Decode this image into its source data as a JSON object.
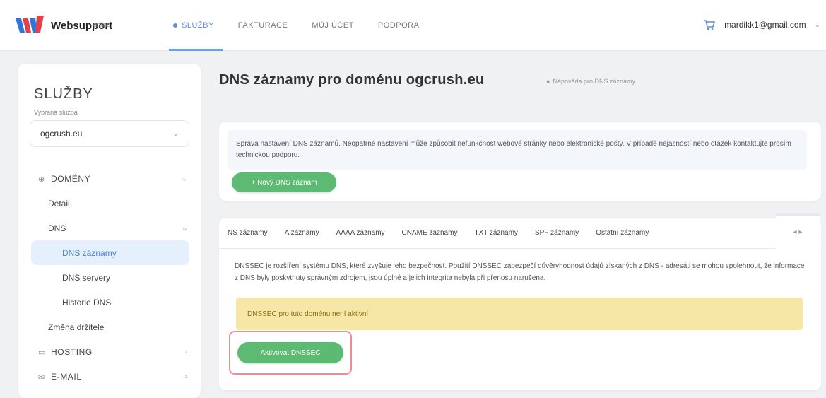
{
  "header": {
    "logo_text": "Websupport",
    "logo_sub": "online",
    "nav": [
      {
        "label": "SLUŽBY",
        "active": true
      },
      {
        "label": "FAKTURACE",
        "active": false
      },
      {
        "label": "MŮJ ÚČET",
        "active": false
      },
      {
        "label": "PODPORA",
        "active": false
      }
    ],
    "user_email": "mardikk1@gmail.com"
  },
  "sidebar": {
    "title": "SLUŽBY",
    "subtitle": "Vybraná služba",
    "selected_domain": "ogcrush.eu",
    "menu": [
      {
        "label": "DOMÉNY",
        "level": "top",
        "icon": "globe-icon",
        "arrow": "⌄"
      },
      {
        "label": "Detail",
        "level": "sub"
      },
      {
        "label": "DNS",
        "level": "sub",
        "arrow": "⌄"
      },
      {
        "label": "DNS záznamy",
        "level": "subsub",
        "active": true
      },
      {
        "label": "DNS servery",
        "level": "subsub"
      },
      {
        "label": "Historie DNS",
        "level": "subsub"
      },
      {
        "label": "Změna držitele",
        "level": "sub"
      },
      {
        "label": "HOSTING",
        "level": "top",
        "icon": "server-icon",
        "arrow": "›"
      },
      {
        "label": "E-MAIL",
        "level": "top",
        "icon": "mail-icon",
        "arrow": "›"
      }
    ]
  },
  "main": {
    "title": "DNS záznamy pro doménu ogcrush.eu",
    "title_hint": "Nápověda pro DNS záznamy",
    "info_text": "Správa nastavení DNS záznamů. Neopatrné nastavení může způsobit nefunkčnost webové stránky nebo elektronické pošty. V případě nejasností nebo otázek kontaktujte prosím technickou podporu.",
    "new_record_button": "+ Nový DNS záznam",
    "tabs": [
      "NS záznamy",
      "A záznamy",
      "AAAA záznamy",
      "CNAME záznamy",
      "TXT záznamy",
      "SPF záznamy",
      "Ostatní záznamy"
    ],
    "tab_toggle": "◂ ▸",
    "dnssec_desc": "DNSSEC je rozšíření systému DNS, které zvyšuje jeho bezpečnost. Použití DNSSEC zabezpečí důvěryhodnost údajů získaných z DNS - adresáti se mohou spolehnout, že informace z DNS byly poskytnuty správným zdrojem, jsou úplné a jejich integrita nebyla při přenosu narušena.",
    "warning_text": "DNSSEC pro tuto doménu není aktivní",
    "activate_button": "Aktivovat DNSSEC"
  },
  "colors": {
    "accent": "#5b8ee0",
    "green": "#5dba72",
    "warning_bg": "#f7e7a6",
    "highlight": "#f08c96"
  }
}
